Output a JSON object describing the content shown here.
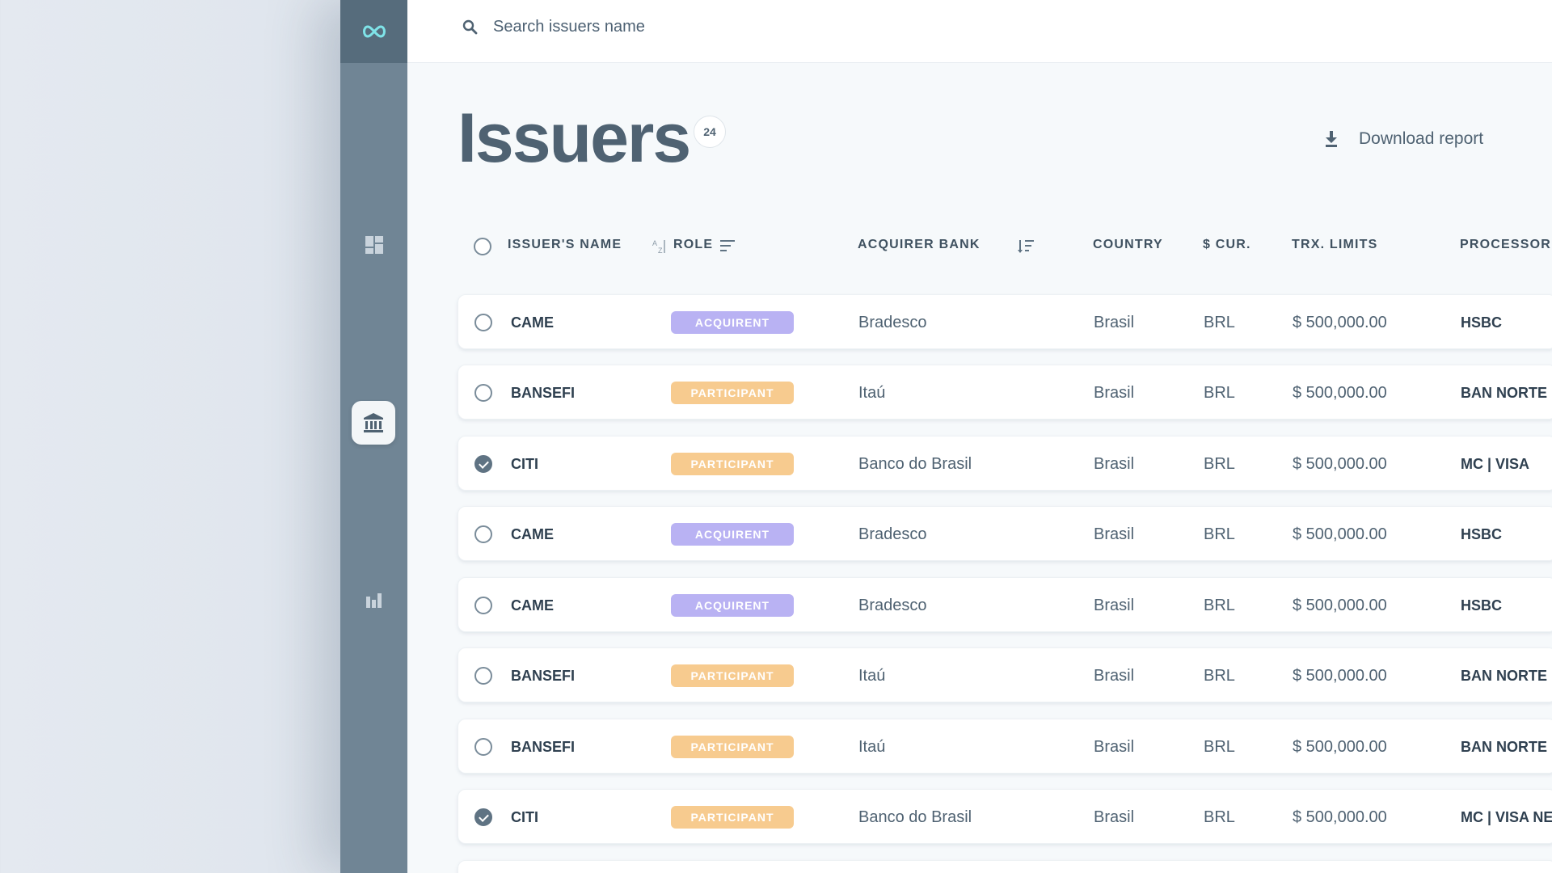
{
  "search": {
    "placeholder": "Search issuers name"
  },
  "page": {
    "title": "Issuers",
    "count": "24",
    "download_label": "Download report"
  },
  "columns": {
    "name": "ISSUER'S NAME",
    "role": "ROLE",
    "bank": "ACQUIRER BANK",
    "country": "COUNTRY",
    "currency": "$ CUR.",
    "limits": "TRX. LIMITS",
    "processor": "PROCESSOR"
  },
  "role_colors": {
    "ACQUIRENT": "#b9b2f3",
    "PARTICIPANT": "#f7cb8f"
  },
  "rows": [
    {
      "checked": false,
      "name": "CAME",
      "role": "ACQUIRENT",
      "bank": "Bradesco",
      "country": "Brasil",
      "currency": "BRL",
      "limit": "$ 500,000.00",
      "processor": "HSBC"
    },
    {
      "checked": false,
      "name": "BANSEFI",
      "role": "PARTICIPANT",
      "bank": "Itaú",
      "country": "Brasil",
      "currency": "BRL",
      "limit": "$ 500,000.00",
      "processor": "BAN NORTE"
    },
    {
      "checked": true,
      "name": "CITI",
      "role": "PARTICIPANT",
      "bank": "Banco do Brasil",
      "country": "Brasil",
      "currency": "BRL",
      "limit": "$ 500,000.00",
      "processor": "MC | VISA"
    },
    {
      "checked": false,
      "name": "CAME",
      "role": "ACQUIRENT",
      "bank": "Bradesco",
      "country": "Brasil",
      "currency": "BRL",
      "limit": "$ 500,000.00",
      "processor": "HSBC"
    },
    {
      "checked": false,
      "name": "CAME",
      "role": "ACQUIRENT",
      "bank": "Bradesco",
      "country": "Brasil",
      "currency": "BRL",
      "limit": "$ 500,000.00",
      "processor": "HSBC"
    },
    {
      "checked": false,
      "name": "BANSEFI",
      "role": "PARTICIPANT",
      "bank": "Itaú",
      "country": "Brasil",
      "currency": "BRL",
      "limit": "$ 500,000.00",
      "processor": "BAN NORTE"
    },
    {
      "checked": false,
      "name": "BANSEFI",
      "role": "PARTICIPANT",
      "bank": "Itaú",
      "country": "Brasil",
      "currency": "BRL",
      "limit": "$ 500,000.00",
      "processor": "BAN NORTE"
    },
    {
      "checked": true,
      "name": "CITI",
      "role": "PARTICIPANT",
      "bank": "Banco do Brasil",
      "country": "Brasil",
      "currency": "BRL",
      "limit": "$ 500,000.00",
      "processor": "MC | VISA NE"
    }
  ]
}
